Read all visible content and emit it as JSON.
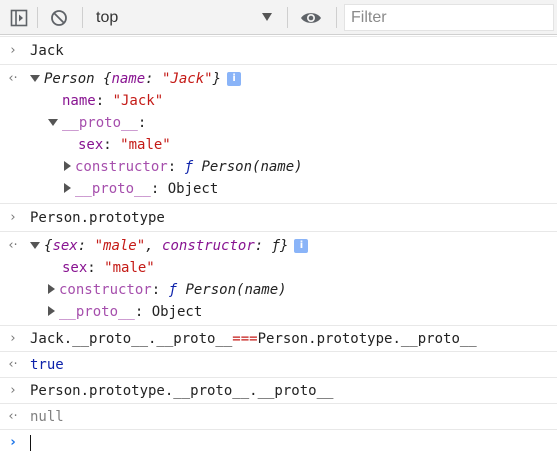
{
  "toolbar": {
    "context": "top",
    "filter_placeholder": "Filter"
  },
  "console": {
    "input1": "Jack",
    "out1_head_obj": "Person",
    "out1_head_key": "name",
    "out1_head_val": "\"Jack\"",
    "out1_name_key": "name",
    "out1_name_val": "\"Jack\"",
    "proto_label": "__proto__",
    "sex_key": "sex",
    "sex_val": "\"male\"",
    "constructor_key": "constructor",
    "f_symbol": "ƒ",
    "ctor_sig": "Person(name)",
    "object_label": "Object",
    "input2": "Person.prototype",
    "out2_head_constructor": "constructor",
    "input3_a": "Jack.__proto__.__proto__",
    "input3_op": "===",
    "input3_b": "Person.prototype.__proto__",
    "out3": "true",
    "input4": "Person.prototype.__proto__.__proto__",
    "out4": "null"
  }
}
